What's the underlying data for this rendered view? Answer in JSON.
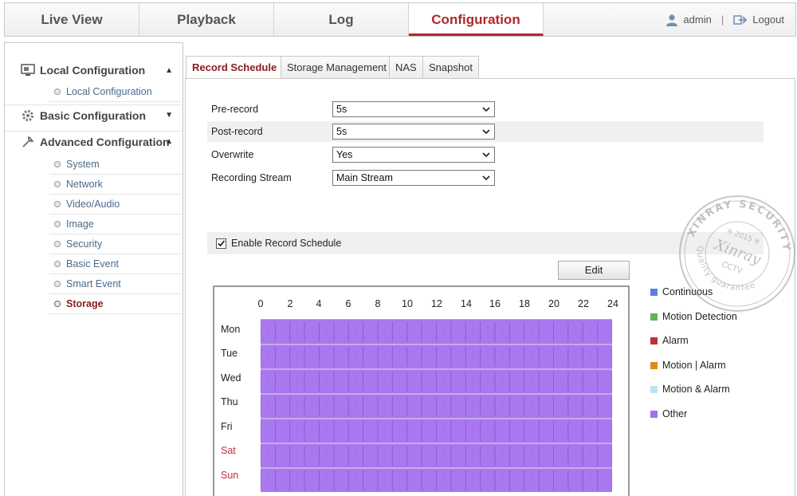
{
  "nav": {
    "tabs": [
      {
        "label": "Live View"
      },
      {
        "label": "Playback"
      },
      {
        "label": "Log"
      },
      {
        "label": "Configuration"
      }
    ],
    "user": "admin",
    "separator": "|",
    "logout": "Logout"
  },
  "sidebar": {
    "groups": [
      {
        "label": "Local Configuration",
        "chevron": "▲"
      },
      {
        "label": "Basic Configuration",
        "chevron": "▼"
      },
      {
        "label": "Advanced Configuration",
        "chevron": "▲"
      }
    ],
    "local_items": [
      "Local Configuration"
    ],
    "advanced_items": [
      "System",
      "Network",
      "Video/Audio",
      "Image",
      "Security",
      "Basic Event",
      "Smart Event",
      "Storage"
    ]
  },
  "content": {
    "tabs": [
      "Record Schedule",
      "Storage Management",
      "NAS",
      "Snapshot"
    ],
    "fields": [
      {
        "label": "Pre-record",
        "value": "5s"
      },
      {
        "label": "Post-record",
        "value": "5s"
      },
      {
        "label": "Overwrite",
        "value": "Yes"
      },
      {
        "label": "Recording Stream",
        "value": "Main Stream"
      }
    ],
    "enable_label": "Enable Record Schedule",
    "enable_checked": true,
    "edit_label": "Edit",
    "hours": [
      "0",
      "2",
      "4",
      "6",
      "8",
      "10",
      "12",
      "14",
      "16",
      "18",
      "20",
      "22",
      "24"
    ],
    "days": [
      "Mon",
      "Tue",
      "Wed",
      "Thu",
      "Fri",
      "Sat",
      "Sun"
    ],
    "schedule_fill_color": "#a977ef",
    "legend": [
      {
        "label": "Continuous",
        "color": "#5b80e0"
      },
      {
        "label": "Motion Detection",
        "color": "#5fb55a"
      },
      {
        "label": "Alarm",
        "color": "#b8323a"
      },
      {
        "label": "Motion | Alarm",
        "color": "#e08a1a"
      },
      {
        "label": "Motion & Alarm",
        "color": "#bfe3f3"
      },
      {
        "label": "Other",
        "color": "#a46ff0"
      }
    ]
  },
  "watermark": {
    "brand": "XINRAY SECURITY",
    "year": "※ 2015 ※",
    "logo": "Xinray",
    "cctv": "CCTV",
    "motto": "Quality guarantee"
  }
}
